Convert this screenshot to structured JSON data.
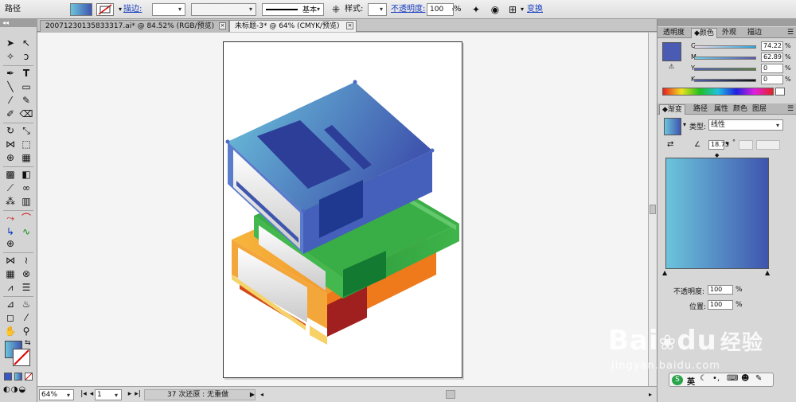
{
  "control_bar": {
    "object_type": "路径",
    "stroke_label": "描边:",
    "stroke_style": "基本",
    "style_label": "样式:",
    "opacity_label": "不透明度:",
    "opacity_value": "100",
    "opacity_unit": "%",
    "transform_label": "变换"
  },
  "tabs": [
    {
      "label": "20071230135833317.ai* @ 84.52% (RGB/预览)"
    },
    {
      "label": "未标题-3* @ 64% (CMYK/预览)"
    }
  ],
  "status": {
    "zoom": "64%",
    "page": "1",
    "undo_text": "37 次还原 : 无重做"
  },
  "panels": {
    "top_tabs": [
      "透明度",
      "颜色",
      "外观",
      "描边"
    ],
    "color": {
      "channels": [
        {
          "name": "C",
          "value": "74.22",
          "unit": "%"
        },
        {
          "name": "M",
          "value": "62.89",
          "unit": "%"
        },
        {
          "name": "Y",
          "value": "0",
          "unit": "%"
        },
        {
          "name": "K",
          "value": "0",
          "unit": "%"
        }
      ],
      "swatch_color": "#4a5bb3"
    },
    "gradient_tabs": [
      "渐变",
      "路径",
      "属性",
      "颜色",
      "图层"
    ],
    "gradient": {
      "type_label": "类型:",
      "type_value": "线性",
      "angle_value": "18.75",
      "angle_unit": "°",
      "opacity_label": "不透明度:",
      "opacity_value": "100",
      "location_label": "位置:",
      "location_value": "100",
      "unit": "%",
      "start_color": "#6cc4dc",
      "end_color": "#3f55ae"
    }
  },
  "watermark": {
    "brand": "Bai",
    "brand2": "du",
    "cn": "经验",
    "url": "jingyan.baidu.com"
  },
  "ime": {
    "lang": "英"
  }
}
